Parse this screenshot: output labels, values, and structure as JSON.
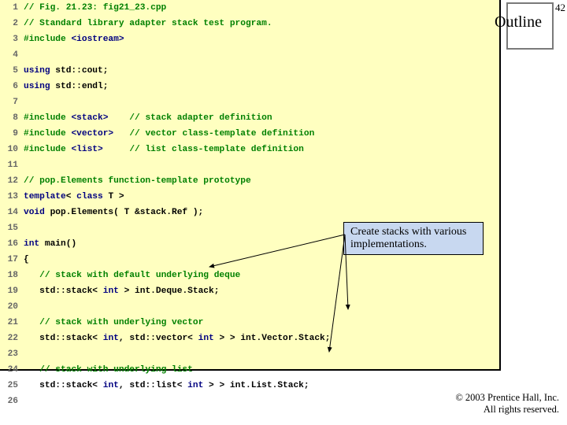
{
  "page_number": "42",
  "outline_label": "Outline",
  "callout_text": "Create stacks with various implementations.",
  "copyright_line1": "© 2003 Prentice Hall, Inc.",
  "copyright_line2": "All rights reserved.",
  "code_lines": [
    {
      "n": "1",
      "pre": "",
      "seg": [
        {
          "c": "c-comment",
          "t": "// Fig. 21.23: fig21_23.cpp"
        }
      ]
    },
    {
      "n": "2",
      "pre": "",
      "seg": [
        {
          "c": "c-comment",
          "t": "// Standard library adapter stack test program."
        }
      ]
    },
    {
      "n": "3",
      "pre": "",
      "seg": [
        {
          "c": "c-pre",
          "t": "#include "
        },
        {
          "c": "c-kw",
          "t": "<iostream>"
        }
      ]
    },
    {
      "n": "4",
      "pre": "",
      "seg": []
    },
    {
      "n": "5",
      "pre": "",
      "seg": [
        {
          "c": "c-kw",
          "t": "using"
        },
        {
          "c": "c-id",
          "t": " std::cout;"
        }
      ]
    },
    {
      "n": "6",
      "pre": "",
      "seg": [
        {
          "c": "c-kw",
          "t": "using"
        },
        {
          "c": "c-id",
          "t": " std::endl;"
        }
      ]
    },
    {
      "n": "7",
      "pre": "",
      "seg": []
    },
    {
      "n": "8",
      "pre": "",
      "seg": [
        {
          "c": "c-pre",
          "t": "#include "
        },
        {
          "c": "c-kw",
          "t": "<stack>"
        },
        {
          "c": "c-id",
          "t": "    "
        },
        {
          "c": "c-comment",
          "t": "// stack adapter definition"
        }
      ]
    },
    {
      "n": "9",
      "pre": "",
      "seg": [
        {
          "c": "c-pre",
          "t": "#include "
        },
        {
          "c": "c-kw",
          "t": "<vector>"
        },
        {
          "c": "c-id",
          "t": "   "
        },
        {
          "c": "c-comment",
          "t": "// vector class-template definition"
        }
      ]
    },
    {
      "n": "10",
      "pre": "",
      "seg": [
        {
          "c": "c-pre",
          "t": "#include "
        },
        {
          "c": "c-kw",
          "t": "<list>"
        },
        {
          "c": "c-id",
          "t": "     "
        },
        {
          "c": "c-comment",
          "t": "// list class-template definition"
        }
      ]
    },
    {
      "n": "11",
      "pre": "",
      "seg": []
    },
    {
      "n": "12",
      "pre": "",
      "seg": [
        {
          "c": "c-comment",
          "t": "// pop.Elements function-template prototype"
        }
      ]
    },
    {
      "n": "13",
      "pre": "",
      "seg": [
        {
          "c": "c-kw",
          "t": "template"
        },
        {
          "c": "c-id",
          "t": "< "
        },
        {
          "c": "c-kw",
          "t": "class"
        },
        {
          "c": "c-id",
          "t": " T >"
        }
      ]
    },
    {
      "n": "14",
      "pre": "",
      "seg": [
        {
          "c": "c-kw",
          "t": "void"
        },
        {
          "c": "c-id",
          "t": " pop.Elements( T &stack.Ref );"
        }
      ]
    },
    {
      "n": "15",
      "pre": "",
      "seg": []
    },
    {
      "n": "16",
      "pre": "",
      "seg": [
        {
          "c": "c-kw",
          "t": "int"
        },
        {
          "c": "c-id",
          "t": " main()"
        }
      ]
    },
    {
      "n": "17",
      "pre": "",
      "seg": [
        {
          "c": "c-id",
          "t": "{"
        }
      ]
    },
    {
      "n": "18",
      "pre": "   ",
      "seg": [
        {
          "c": "c-comment",
          "t": "// stack with default underlying deque"
        }
      ]
    },
    {
      "n": "19",
      "pre": "   ",
      "seg": [
        {
          "c": "c-id",
          "t": "std::stack< "
        },
        {
          "c": "c-kw",
          "t": "int"
        },
        {
          "c": "c-id",
          "t": " > int.Deque.Stack;"
        }
      ]
    },
    {
      "n": "20",
      "pre": "",
      "seg": []
    },
    {
      "n": "21",
      "pre": "   ",
      "seg": [
        {
          "c": "c-comment",
          "t": "// stack with underlying vector"
        }
      ]
    },
    {
      "n": "22",
      "pre": "   ",
      "seg": [
        {
          "c": "c-id",
          "t": "std::stack< "
        },
        {
          "c": "c-kw",
          "t": "int"
        },
        {
          "c": "c-id",
          "t": ", std::vector< "
        },
        {
          "c": "c-kw",
          "t": "int"
        },
        {
          "c": "c-id",
          "t": " > > int.Vector.Stack;"
        }
      ]
    },
    {
      "n": "23",
      "pre": "",
      "seg": []
    },
    {
      "n": "24",
      "pre": "   ",
      "seg": [
        {
          "c": "c-comment",
          "t": "// stack with underlying list"
        }
      ]
    },
    {
      "n": "25",
      "pre": "   ",
      "seg": [
        {
          "c": "c-id",
          "t": "std::stack< "
        },
        {
          "c": "c-kw",
          "t": "int"
        },
        {
          "c": "c-id",
          "t": ", std::list< "
        },
        {
          "c": "c-kw",
          "t": "int"
        },
        {
          "c": "c-id",
          "t": " > > int.List.Stack;"
        }
      ]
    },
    {
      "n": "26",
      "pre": "",
      "seg": []
    }
  ]
}
